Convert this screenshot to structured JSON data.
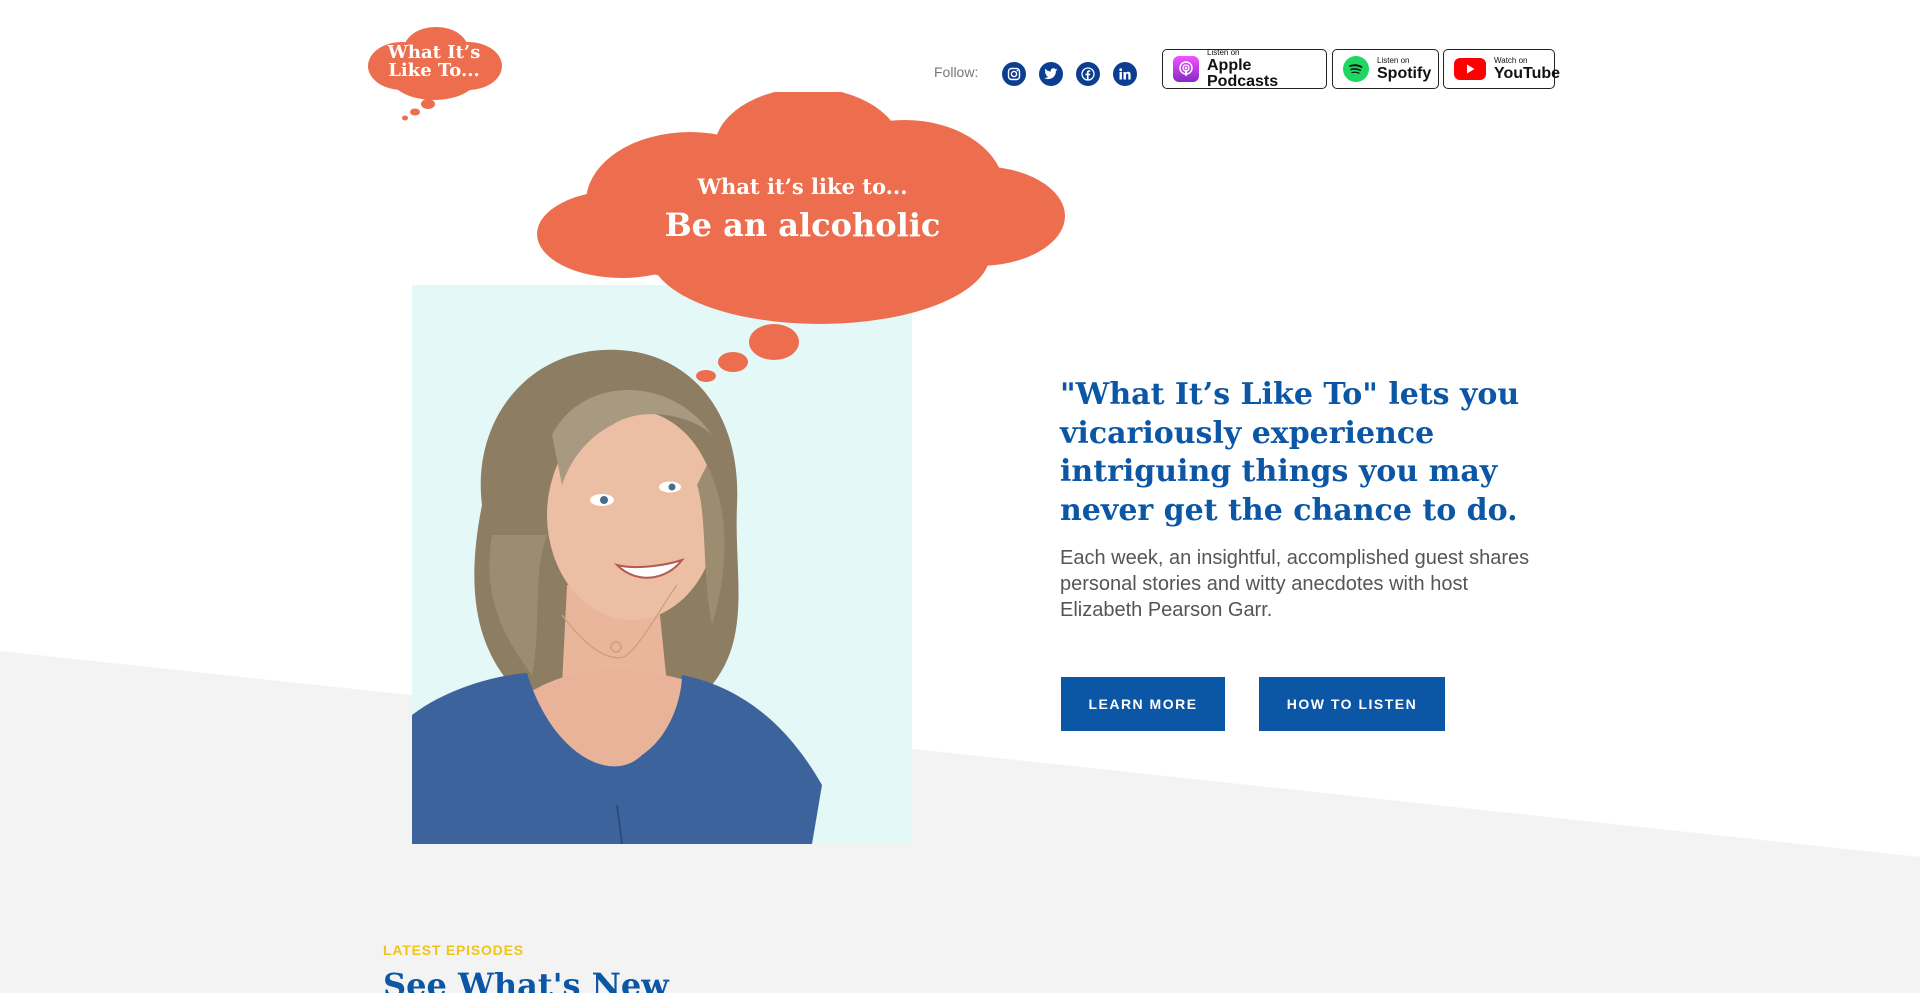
{
  "colors": {
    "accent": "#ed6e4f",
    "brand_blue": "#0b56a5",
    "social_blue": "#0b3d91",
    "gray_band": "#f3f3f3",
    "eyebrow_yellow": "#f0c419",
    "photo_bg": "#e4f8f7"
  },
  "header": {
    "logo": {
      "line1": "What It’s",
      "line2": "Like To..."
    },
    "follow_label": "Follow:",
    "social_icons": [
      "instagram-icon",
      "twitter-icon",
      "facebook-icon",
      "linkedin-icon"
    ],
    "badges": [
      {
        "small": "Listen on",
        "big": "Apple Podcasts",
        "icon": "apple-podcasts-icon"
      },
      {
        "small": "Listen on",
        "big": "Spotify",
        "icon": "spotify-icon"
      },
      {
        "small": "Watch on",
        "big": "YouTube",
        "icon": "youtube-icon"
      }
    ]
  },
  "hero": {
    "cloud_subtitle": "What it’s like to...",
    "cloud_title": "Be an alcoholic",
    "headline": "\"What It’s Like To\" lets you vicariously experience intriguing things you may never get the chance to do.",
    "description": "Each week, an insightful, accomplished guest shares personal stories and witty anecdotes with host Elizabeth Pearson Garr.",
    "buttons": {
      "learn_more": "LEARN MORE",
      "how_to_listen": "HOW TO LISTEN"
    }
  },
  "latest": {
    "eyebrow": "LATEST EPISODES",
    "title": "See What's New"
  }
}
